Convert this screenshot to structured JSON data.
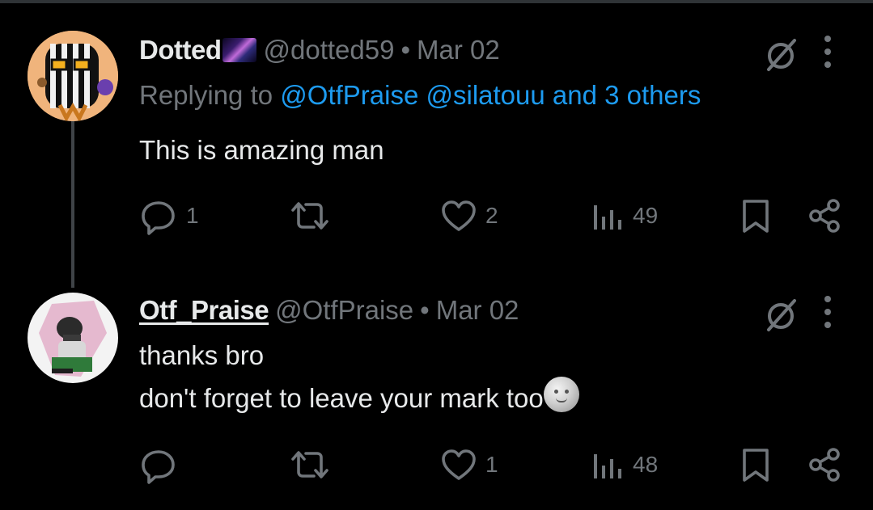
{
  "tweets": [
    {
      "name": "Dotted",
      "badge_icon": "galaxy-emoji-icon",
      "handle": "@dotted59",
      "separator": "•",
      "date": "Mar 02",
      "replying_prefix": "Replying to",
      "replying_to": "@OtfPraise @silatouu and 3 others",
      "lines": [
        "This is amazing man"
      ],
      "replies": "1",
      "retweets": "",
      "likes": "2",
      "views": "49"
    },
    {
      "name": "Otf_Praise",
      "handle": "@OtfPraise",
      "separator": "•",
      "date": "Mar 02",
      "lines": [
        "thanks bro",
        "don't forget to leave your mark too"
      ],
      "emoji_icon": "moon-face-emoji-icon",
      "replies": "",
      "retweets": "",
      "likes": "1",
      "views": "48"
    }
  ],
  "colors": {
    "background": "#000000",
    "text": "#e7e9ea",
    "muted": "#71767b",
    "link": "#1d9bf0",
    "thread_line": "#3f4347"
  }
}
